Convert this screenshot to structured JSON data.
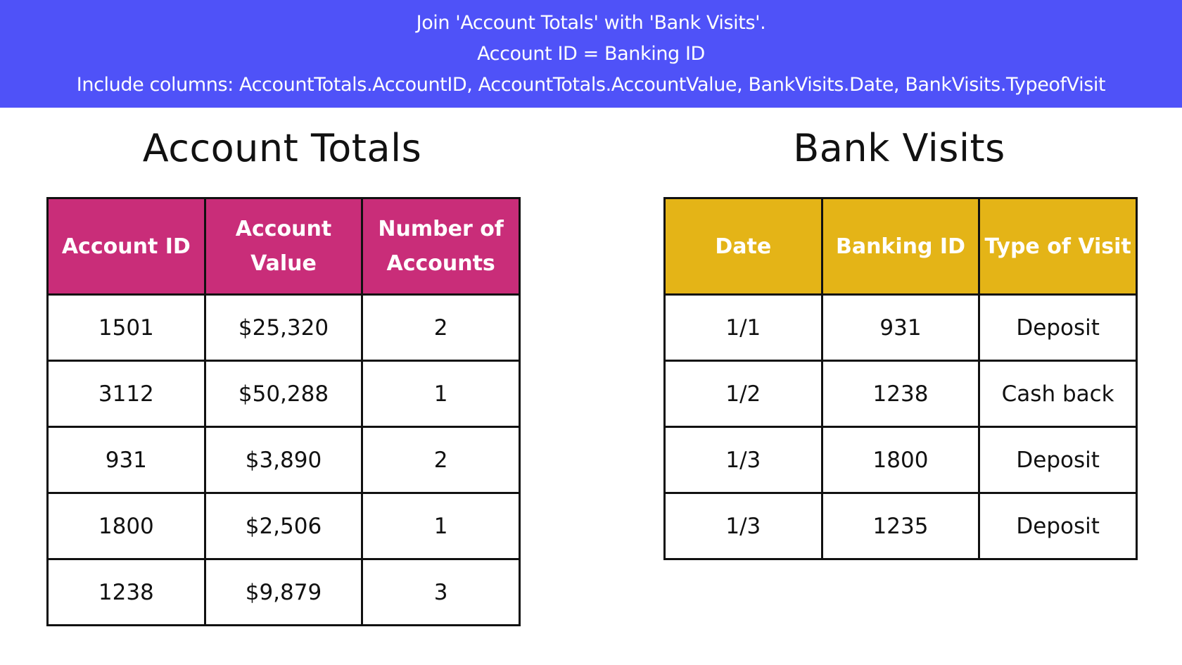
{
  "banner": {
    "line1": "Join 'Account Totals' with 'Bank Visits'.",
    "line2": "Account ID = Banking ID",
    "line3": "Include columns: AccountTotals.AccountID, AccountTotals.AccountValue, BankVisits.Date, BankVisits.TypeofVisit",
    "background_color": "#4f52f8"
  },
  "account_totals": {
    "title": "Account Totals",
    "header_color": "#c92d79",
    "columns": [
      "Account ID",
      "Account Value",
      "Number of Accounts"
    ],
    "rows": [
      [
        "1501",
        "$25,320",
        "2"
      ],
      [
        "3112",
        "$50,288",
        "1"
      ],
      [
        "931",
        "$3,890",
        "2"
      ],
      [
        "1800",
        "$2,506",
        "1"
      ],
      [
        "1238",
        "$9,879",
        "3"
      ]
    ]
  },
  "bank_visits": {
    "title": "Bank Visits",
    "header_color": "#e4b417",
    "columns": [
      "Date",
      "Banking ID",
      "Type of Visit"
    ],
    "rows": [
      [
        "1/1",
        "931",
        "Deposit"
      ],
      [
        "1/2",
        "1238",
        "Cash back"
      ],
      [
        "1/3",
        "1800",
        "Deposit"
      ],
      [
        "1/3",
        "1235",
        "Deposit"
      ]
    ]
  }
}
